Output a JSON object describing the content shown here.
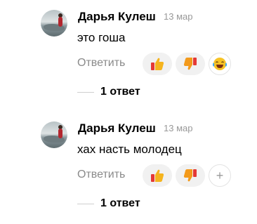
{
  "comments": [
    {
      "author": "Дарья Кулеш",
      "date": "13 мар",
      "text": "это гоша",
      "reply_label": "Ответить",
      "thread_label": "1 ответ",
      "reactions": [
        "thumbs-up-icon",
        "thumbs-down-icon",
        "laughing-emoji-icon"
      ]
    },
    {
      "author": "Дарья Кулеш",
      "date": "13 мар",
      "text": "хах насть молодец",
      "reply_label": "Ответить",
      "thread_label": "1 ответ",
      "reactions": [
        "thumbs-up-icon",
        "thumbs-down-icon",
        "add-reaction-icon"
      ],
      "add_symbol": "+"
    }
  ],
  "colors": {
    "name": "#000000",
    "date": "#999999",
    "reply": "#8a8a8a",
    "reaction_bg": "#f1f1f1",
    "like_yellow": "#f5b41e",
    "like_red": "#e53935",
    "dislike_orange": "#f39a1b"
  }
}
